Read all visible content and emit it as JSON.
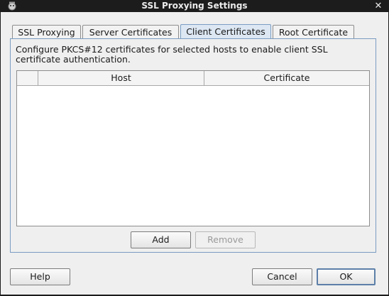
{
  "window": {
    "title": "SSL Proxying Settings",
    "icon": "app-icon",
    "close_glyph": "✕"
  },
  "tabs": [
    {
      "label": "SSL Proxying",
      "active": false
    },
    {
      "label": "Server Certificates",
      "active": false
    },
    {
      "label": "Client Certificates",
      "active": true
    },
    {
      "label": "Root Certificate",
      "active": false
    }
  ],
  "panel": {
    "description": "Configure PKCS#12 certificates for selected hosts to enable client SSL certificate authentication.",
    "table": {
      "columns": [
        "",
        "Host",
        "Certificate"
      ],
      "rows": []
    },
    "add_label": "Add",
    "remove_label": "Remove"
  },
  "footer": {
    "help_label": "Help",
    "cancel_label": "Cancel",
    "ok_label": "OK"
  },
  "colors": {
    "titlebar": "#1c1c1c",
    "active_tab": "#dce7f3",
    "panel_border": "#7a9cc2"
  }
}
